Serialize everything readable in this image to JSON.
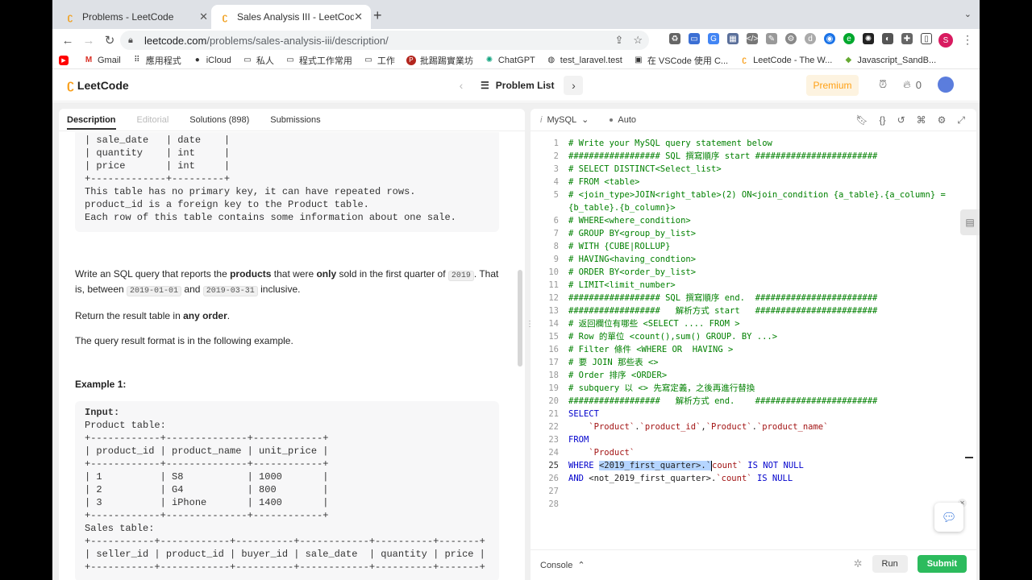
{
  "browser": {
    "tabs": [
      {
        "title": "Problems - LeetCode",
        "active": false
      },
      {
        "title": "Sales Analysis III - LeetCode",
        "active": true
      }
    ],
    "url_host": "leetcode.com",
    "url_path": "/problems/sales-analysis-iii/description/",
    "profile_initial": "S",
    "bookmarks": [
      {
        "label": "",
        "icon": "youtube-icon"
      },
      {
        "label": "Gmail",
        "icon": "gmail-icon"
      },
      {
        "label": "應用程式",
        "icon": "apps-grid-icon"
      },
      {
        "label": "iCloud",
        "icon": "apple-icon"
      },
      {
        "label": "私人",
        "icon": "folder-icon"
      },
      {
        "label": "程式工作常用",
        "icon": "folder-icon"
      },
      {
        "label": "工作",
        "icon": "folder-icon"
      },
      {
        "label": "批踢踢實業坊",
        "icon": "ptt-icon"
      },
      {
        "label": "ChatGPT",
        "icon": "chatgpt-icon"
      },
      {
        "label": "test_laravel.test",
        "icon": "globe-icon"
      },
      {
        "label": "在 VSCode 使用 C...",
        "icon": "image-icon"
      },
      {
        "label": "LeetCode - The W...",
        "icon": "leetcode-icon"
      },
      {
        "label": "Javascript_SandB...",
        "icon": "sandbox-icon"
      }
    ]
  },
  "lc": {
    "logo": "LeetCode",
    "problem_list": "Problem List",
    "premium": "Premium",
    "streak": "0"
  },
  "left_tabs": {
    "description": "Description",
    "editorial": "Editorial",
    "solutions": "Solutions (898)",
    "submissions": "Submissions"
  },
  "desc": {
    "schema_tail": "| sale_date   | date    |\n| quantity    | int     |\n| price       | int     |\n+-------------+---------+\nThis table has no primary key, it can have repeated rows.\nproduct_id is a foreign key to the Product table.\nEach row of this table contains some information about one sale.",
    "p1_a": "Write an SQL query that reports the ",
    "p1_b": "products",
    "p1_c": " that were ",
    "p1_d": "only",
    "p1_e": " sold in the first quarter of ",
    "p1_code1": "2019",
    "p1_f": ". That is, between ",
    "p1_code2": "2019-01-01",
    "p1_g": " and ",
    "p1_code3": "2019-03-31",
    "p1_h": " inclusive.",
    "p2_a": "Return the result table in ",
    "p2_b": "any order",
    "p2_c": ".",
    "p3": "The query result format is in the following example.",
    "example_title": "Example 1:",
    "example_input_label": "Input:",
    "example_body": "Product table:\n+------------+--------------+------------+\n| product_id | product_name | unit_price |\n+------------+--------------+------------+\n| 1          | S8           | 1000       |\n| 2          | G4           | 800        |\n| 3          | iPhone       | 1400       |\n+------------+--------------+------------+\nSales table:\n+-----------+------------+----------+------------+----------+-------+\n| seller_id | product_id | buyer_id | sale_date  | quantity | price |\n+-----------+------------+----------+------------+----------+-------+"
  },
  "editor": {
    "language": "MySQL",
    "mode": "Auto",
    "console": "Console",
    "run": "Run",
    "submit": "Submit"
  }
}
